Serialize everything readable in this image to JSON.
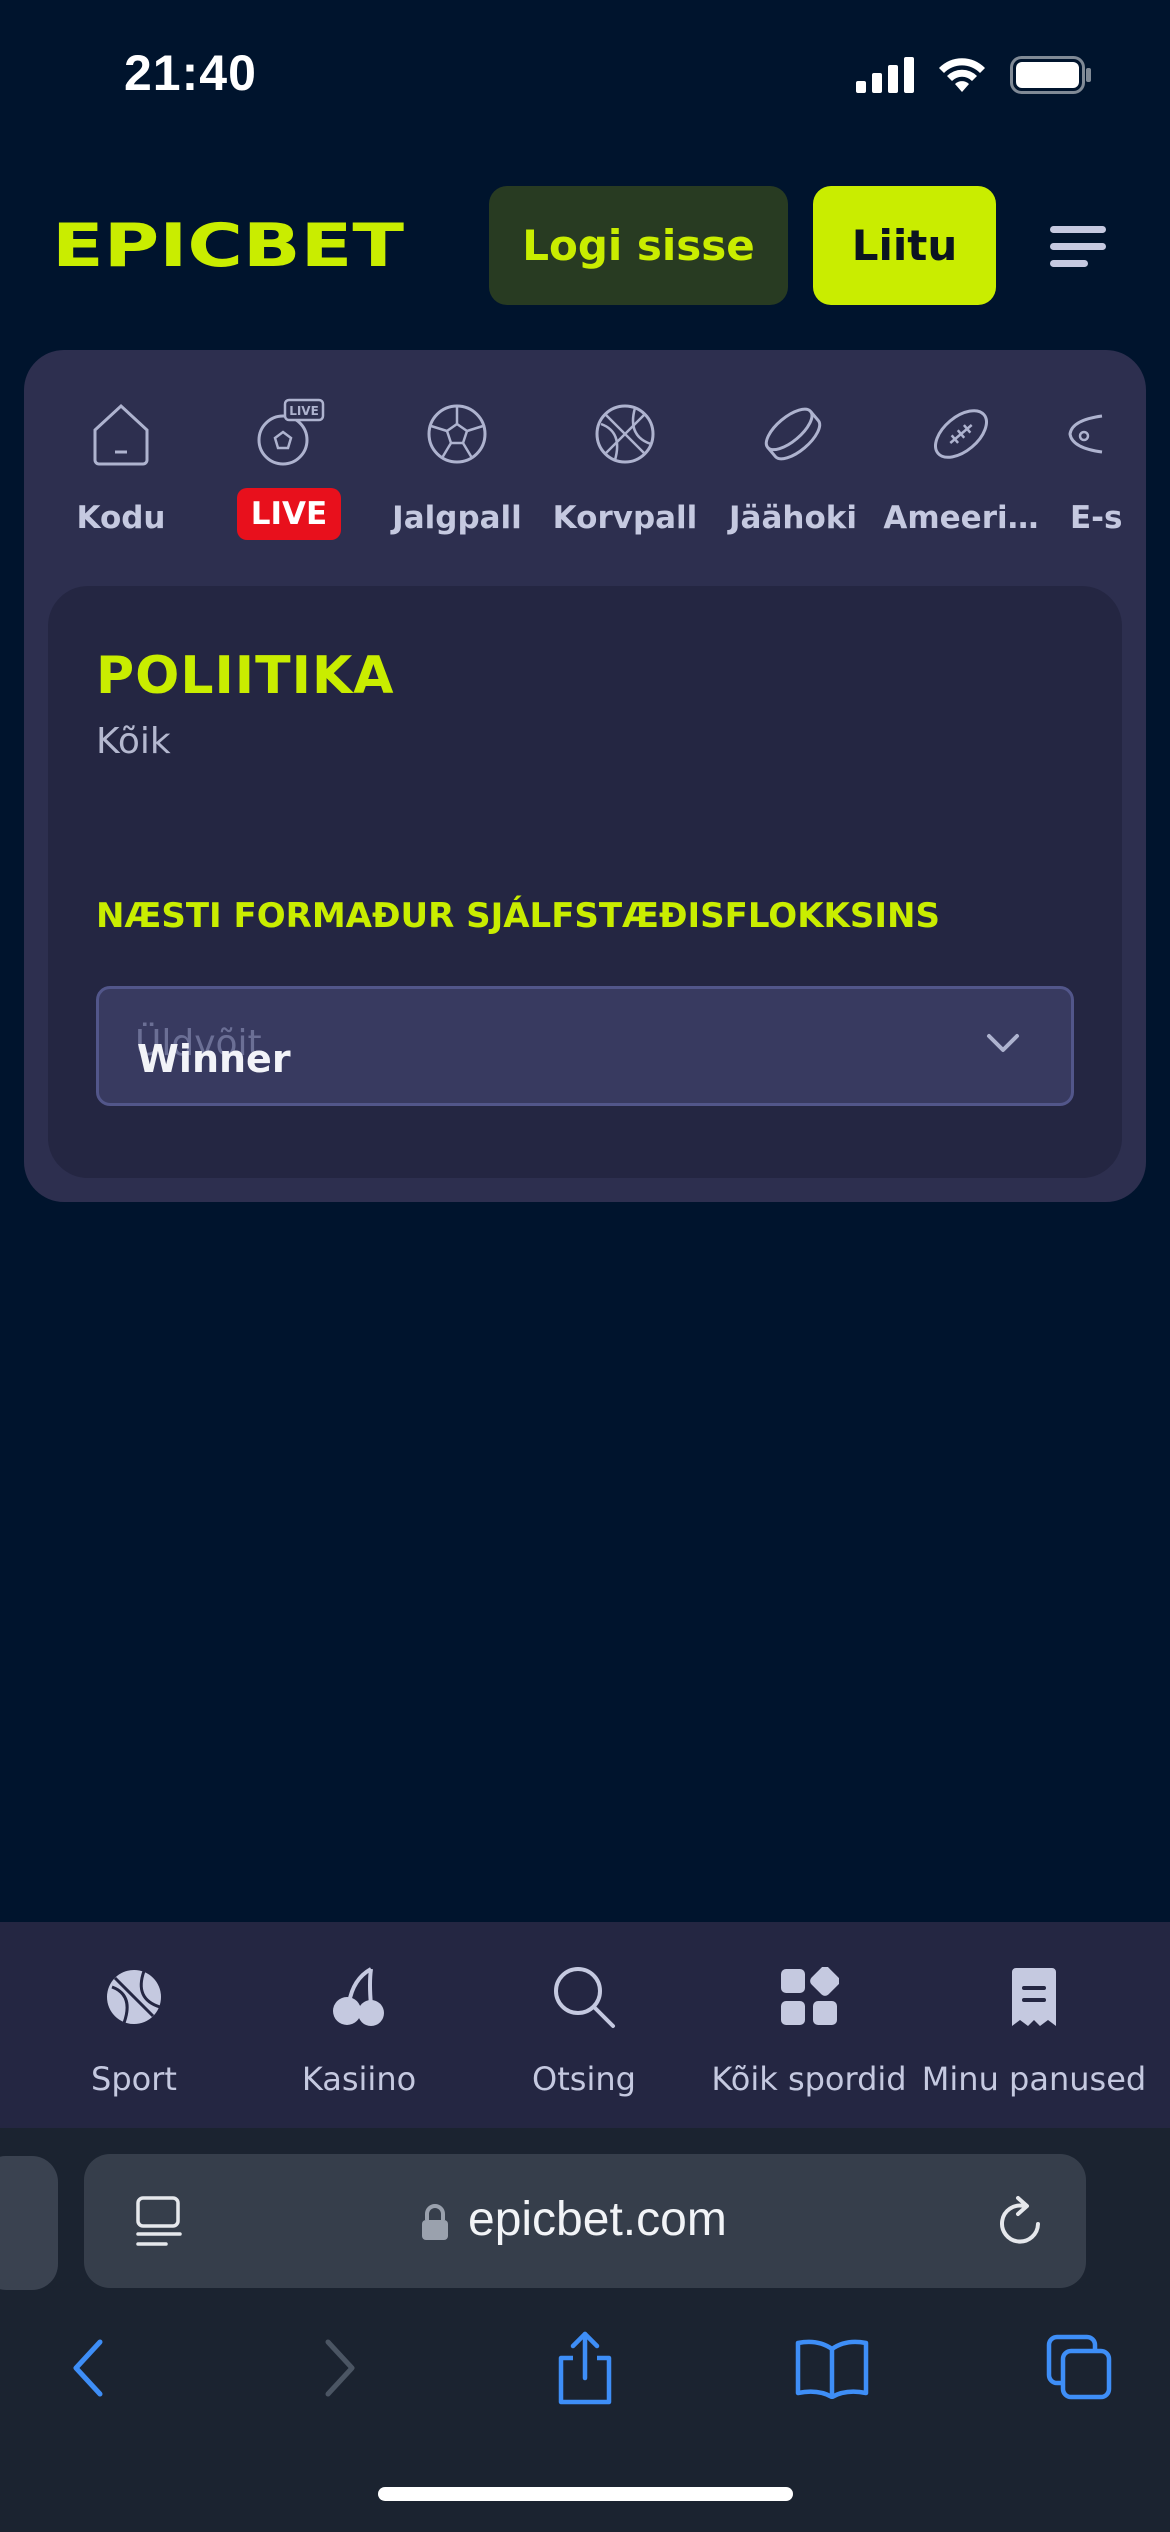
{
  "status_bar": {
    "time": "21:40"
  },
  "header": {
    "logo_text": "EPICBET",
    "login_label": "Logi sisse",
    "join_label": "Liitu"
  },
  "sports_nav": {
    "items": [
      {
        "label": "Kodu",
        "icon": "home-icon"
      },
      {
        "label": "LIVE",
        "icon": "live-soccer-icon"
      },
      {
        "label": "Jalgpall",
        "icon": "soccer-ball-icon"
      },
      {
        "label": "Korvpall",
        "icon": "basketball-icon"
      },
      {
        "label": "Jäähoki",
        "icon": "hockey-puck-icon"
      },
      {
        "label": "Ameeri…",
        "icon": "american-football-icon"
      },
      {
        "label": "E-s",
        "icon": "esports-icon"
      }
    ]
  },
  "category": {
    "title": "POLIITIKA",
    "subtitle": "Kõik",
    "market_title": "NÆSTI FORMAÐUR SJÁLFSTÆÐISFLOKKSINS",
    "select": {
      "placeholder": "Üldvõit",
      "value": "Winner"
    }
  },
  "tab_bar": {
    "items": [
      {
        "label": "Sport",
        "icon": "basketball-icon"
      },
      {
        "label": "Kasiino",
        "icon": "cherries-icon"
      },
      {
        "label": "Otsing",
        "icon": "search-icon"
      },
      {
        "label": "Kõik spordid",
        "icon": "grid-icon"
      },
      {
        "label": "Minu panused",
        "icon": "receipt-icon"
      }
    ]
  },
  "browser": {
    "url": "epicbet.com"
  },
  "colors": {
    "background": "#00142d",
    "accent": "#c9ed00",
    "panel": "#2d2f4f",
    "card": "#242642",
    "live": "#e8101c",
    "browser_blue": "#3e8ef7"
  }
}
